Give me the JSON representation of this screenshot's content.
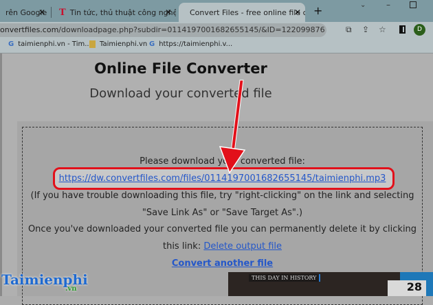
{
  "tabs": [
    {
      "label": "rên Google"
    },
    {
      "label": "Tin tức, thủ thuật công nghệ mới"
    },
    {
      "label": "Convert Files - free online file con"
    }
  ],
  "address": {
    "domain": "onvertfiles.com",
    "path": "/downloadpage.php?subdir=0114197001682655145/&ID=122099876"
  },
  "profile_initial": "D",
  "bookmarks": [
    {
      "label": "taimienphi.vn - Tim..."
    },
    {
      "label": "Taimienphi.vn"
    },
    {
      "label": "https://taimienphi.v..."
    }
  ],
  "page": {
    "title": "Online File Converter",
    "subtitle": "Download your converted file",
    "please": "Please download your converted file:",
    "download_link": "https://dw.convertfiles.com/files/0114197001682655145/taimienphi.mp3",
    "trouble1": "(If you have trouble downloading this file, try \"right-clicking\" on the link and selecting",
    "trouble2": "\"Save Link As\" or \"Save Target As\".)",
    "once": "Once you've downloaded your converted file you can permanently delete it by clicking",
    "this_link": "this link: ",
    "delete_link": "Delete output file",
    "convert_another": "Convert another file"
  },
  "video": {
    "label": "THIS DAY IN HISTORY",
    "day": "28"
  },
  "watermark": {
    "text": "Taimienphi",
    ".vn": ".vn"
  },
  "colors": {
    "highlight": "#e2101a",
    "link": "#2457c9"
  }
}
